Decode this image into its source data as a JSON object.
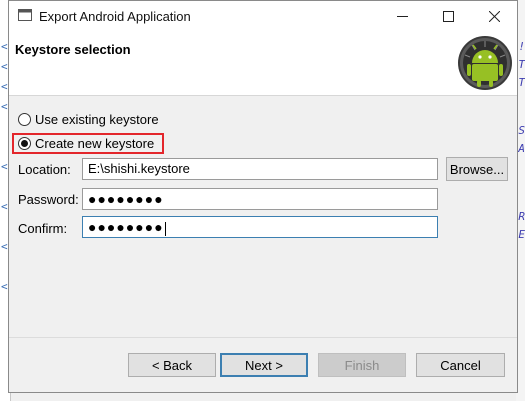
{
  "window": {
    "title": "Export Android Application"
  },
  "banner": {
    "title": "Keystore selection"
  },
  "options": {
    "use_existing": "Use existing keystore",
    "create_new": "Create new keystore",
    "selected": "create_new"
  },
  "fields": {
    "location_label": "Location:",
    "location_value": "E:\\shishi.keystore",
    "password_label": "Password:",
    "password_value": "●●●●●●●●",
    "confirm_label": "Confirm:",
    "confirm_value": "●●●●●●●●"
  },
  "buttons": {
    "browse": "Browse...",
    "back": "< Back",
    "next": "Next >",
    "finish": "Finish",
    "cancel": "Cancel"
  },
  "colors": {
    "highlight": "#e3262b",
    "android_green": "#97c024",
    "focus_border": "#3c7fb1"
  }
}
